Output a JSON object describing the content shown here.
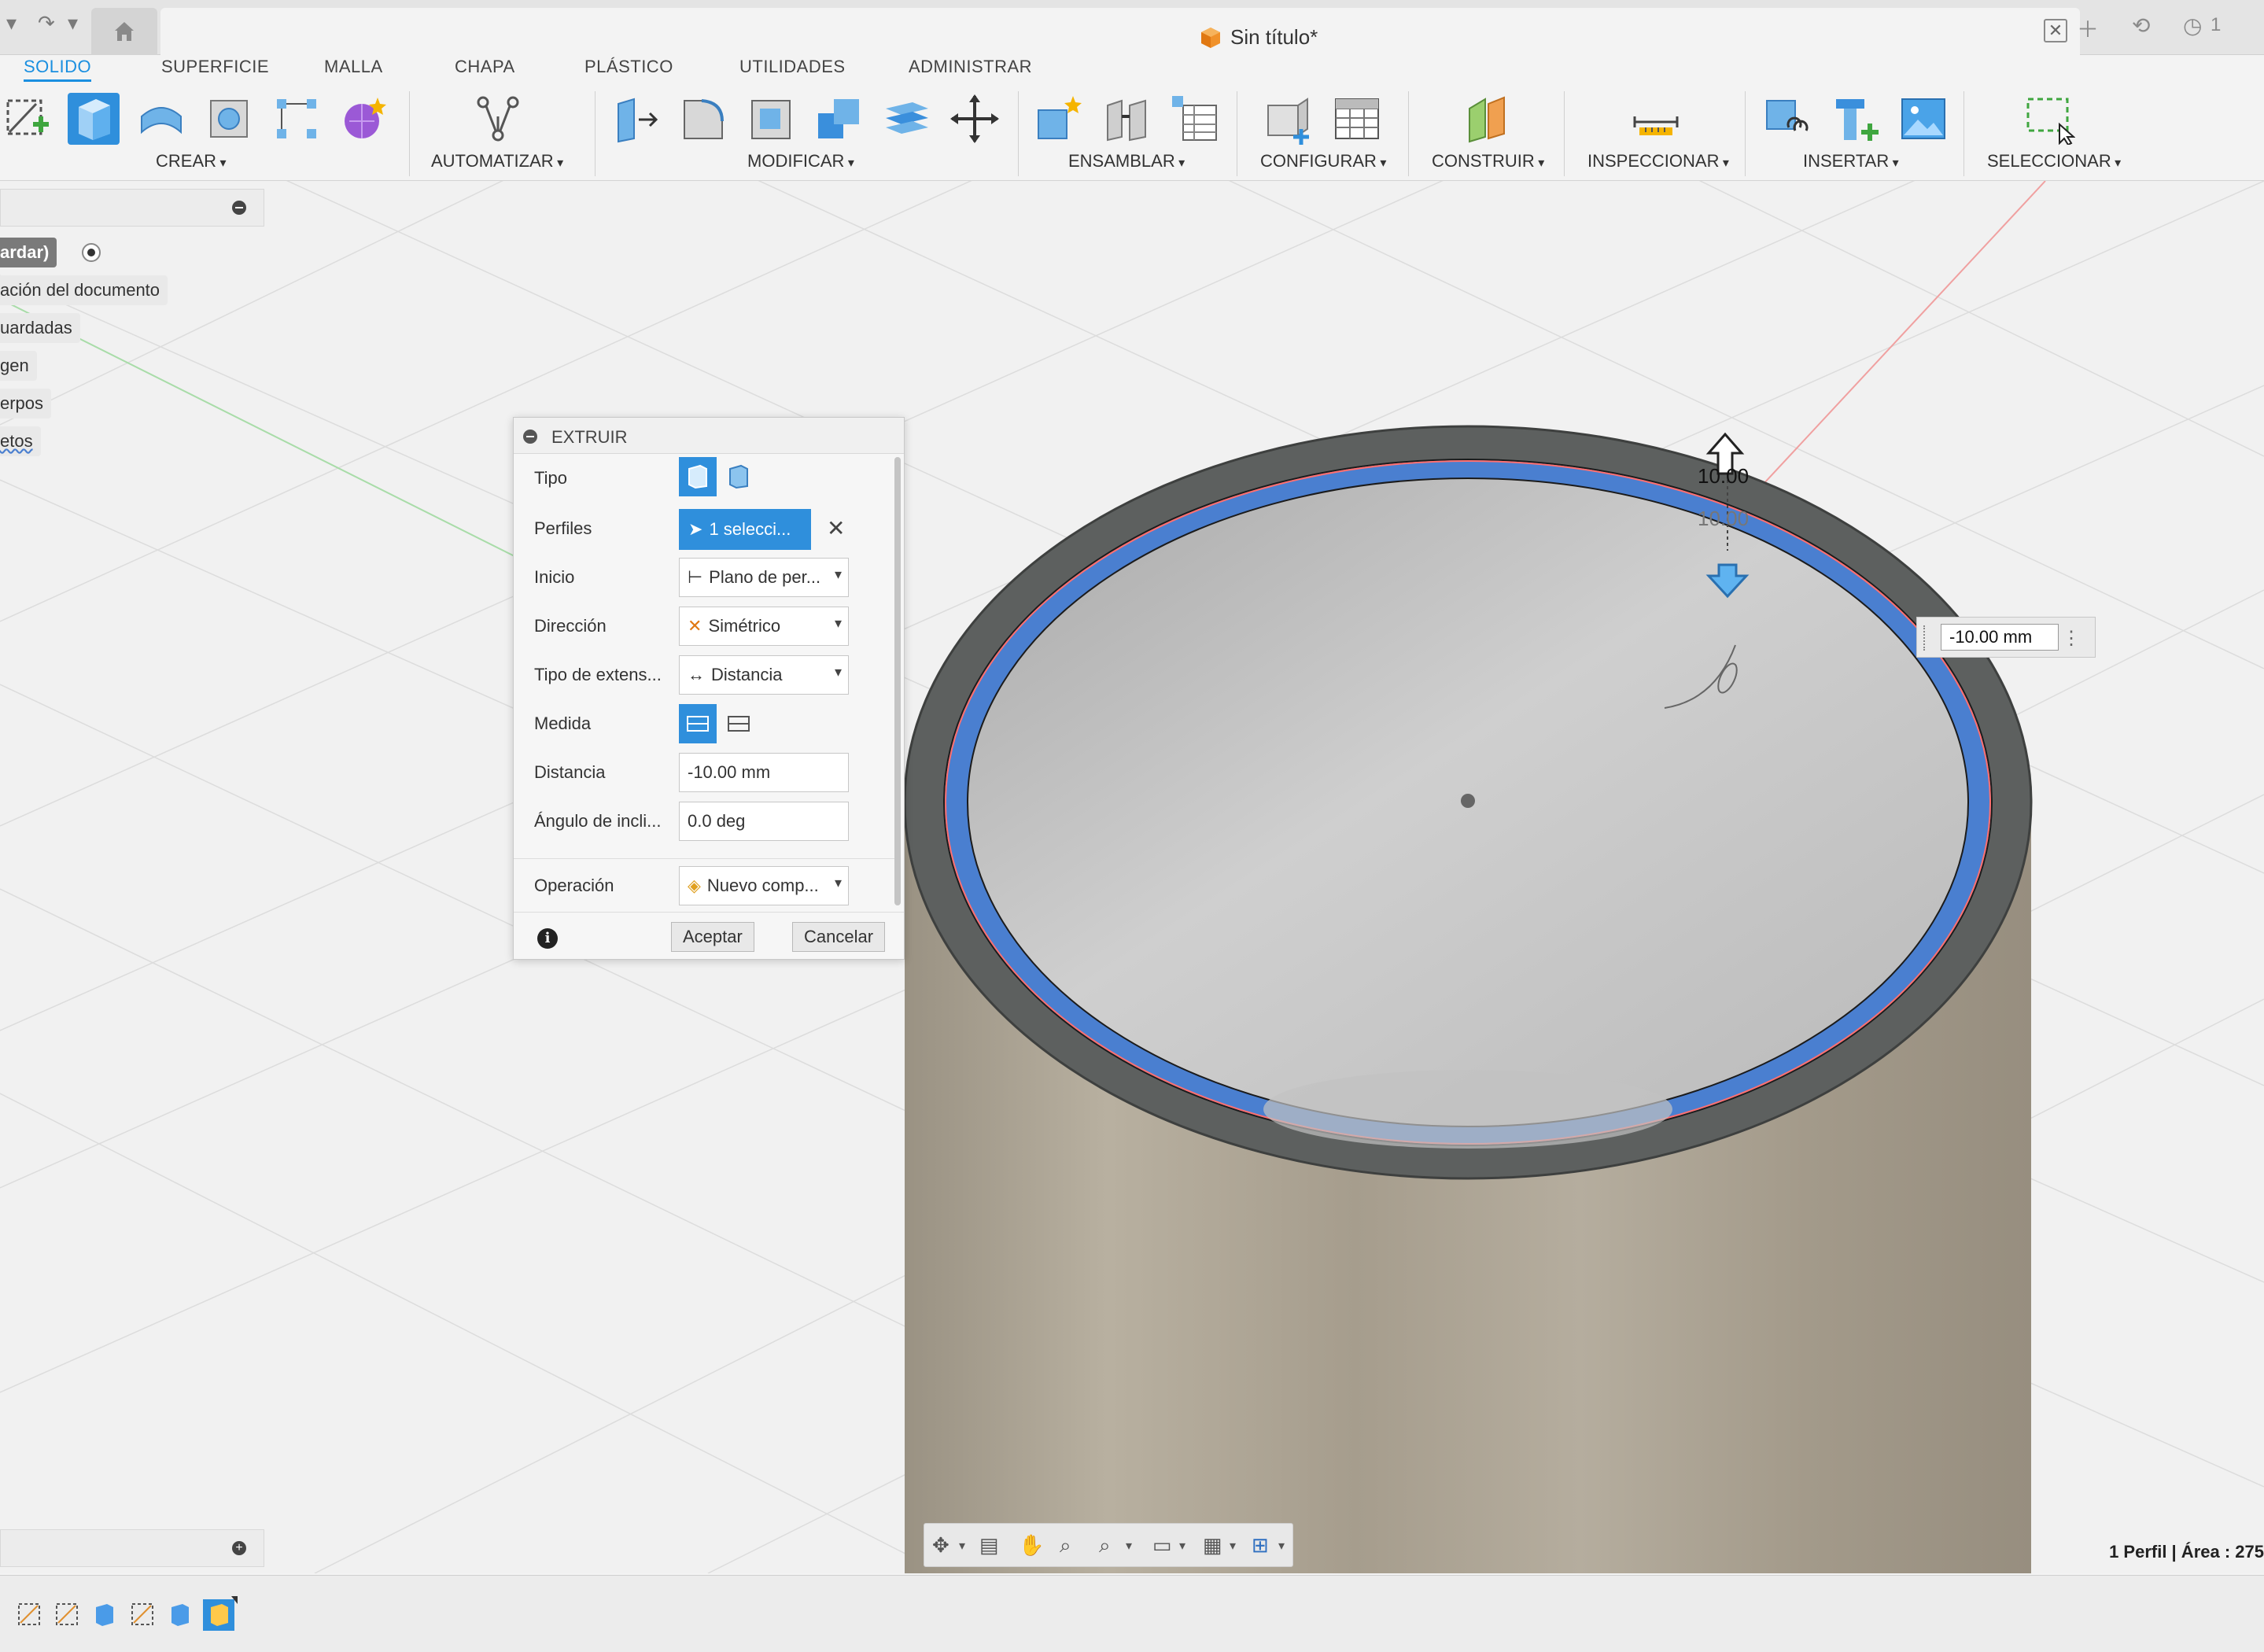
{
  "window": {
    "title": "Sin título*",
    "notifications_count": "1"
  },
  "tabs": [
    {
      "label": "SOLIDO",
      "active": true
    },
    {
      "label": "SUPERFICIE"
    },
    {
      "label": "MALLA"
    },
    {
      "label": "CHAPA"
    },
    {
      "label": "PLÁSTICO"
    },
    {
      "label": "UTILIDADES"
    },
    {
      "label": "ADMINISTRAR"
    }
  ],
  "ribbon_groups": {
    "crear": "CREAR",
    "automatizar": "AUTOMATIZAR",
    "modificar": "MODIFICAR",
    "ensamblar": "ENSAMBLAR",
    "configurar": "CONFIGURAR",
    "construir": "CONSTRUIR",
    "inspeccionar": "INSPECCIONAR",
    "insertar": "INSERTAR",
    "seleccionar": "SELECCIONAR"
  },
  "browser": {
    "items": [
      "ardar)",
      "ación del documento",
      "uardadas",
      "gen",
      "erpos",
      "etos"
    ]
  },
  "dialog": {
    "title": "EXTRUIR",
    "labels": {
      "tipo": "Tipo",
      "perfiles": "Perfiles",
      "inicio": "Inicio",
      "direccion": "Dirección",
      "tipo_extension": "Tipo de extens...",
      "medida": "Medida",
      "distancia": "Distancia",
      "angulo": "Ángulo de incli...",
      "operacion": "Operación"
    },
    "values": {
      "perfiles": "1 selecci...",
      "inicio": "Plano de per...",
      "direccion": "Simétrico",
      "tipo_extension": "Distancia",
      "distancia": "-10.00 mm",
      "angulo": "0.0 deg",
      "operacion": "Nuevo comp..."
    },
    "buttons": {
      "ok": "Aceptar",
      "cancel": "Cancelar"
    }
  },
  "viewport": {
    "distance_input": "-10.00 mm",
    "dim_label_1": "10.00",
    "dim_label_2": "10.00"
  },
  "status": {
    "text": "1 Perfil | Área : 275"
  },
  "colors": {
    "accent": "#2f8fdc",
    "body": "#a89f90",
    "ring": "#4a7fd0"
  }
}
